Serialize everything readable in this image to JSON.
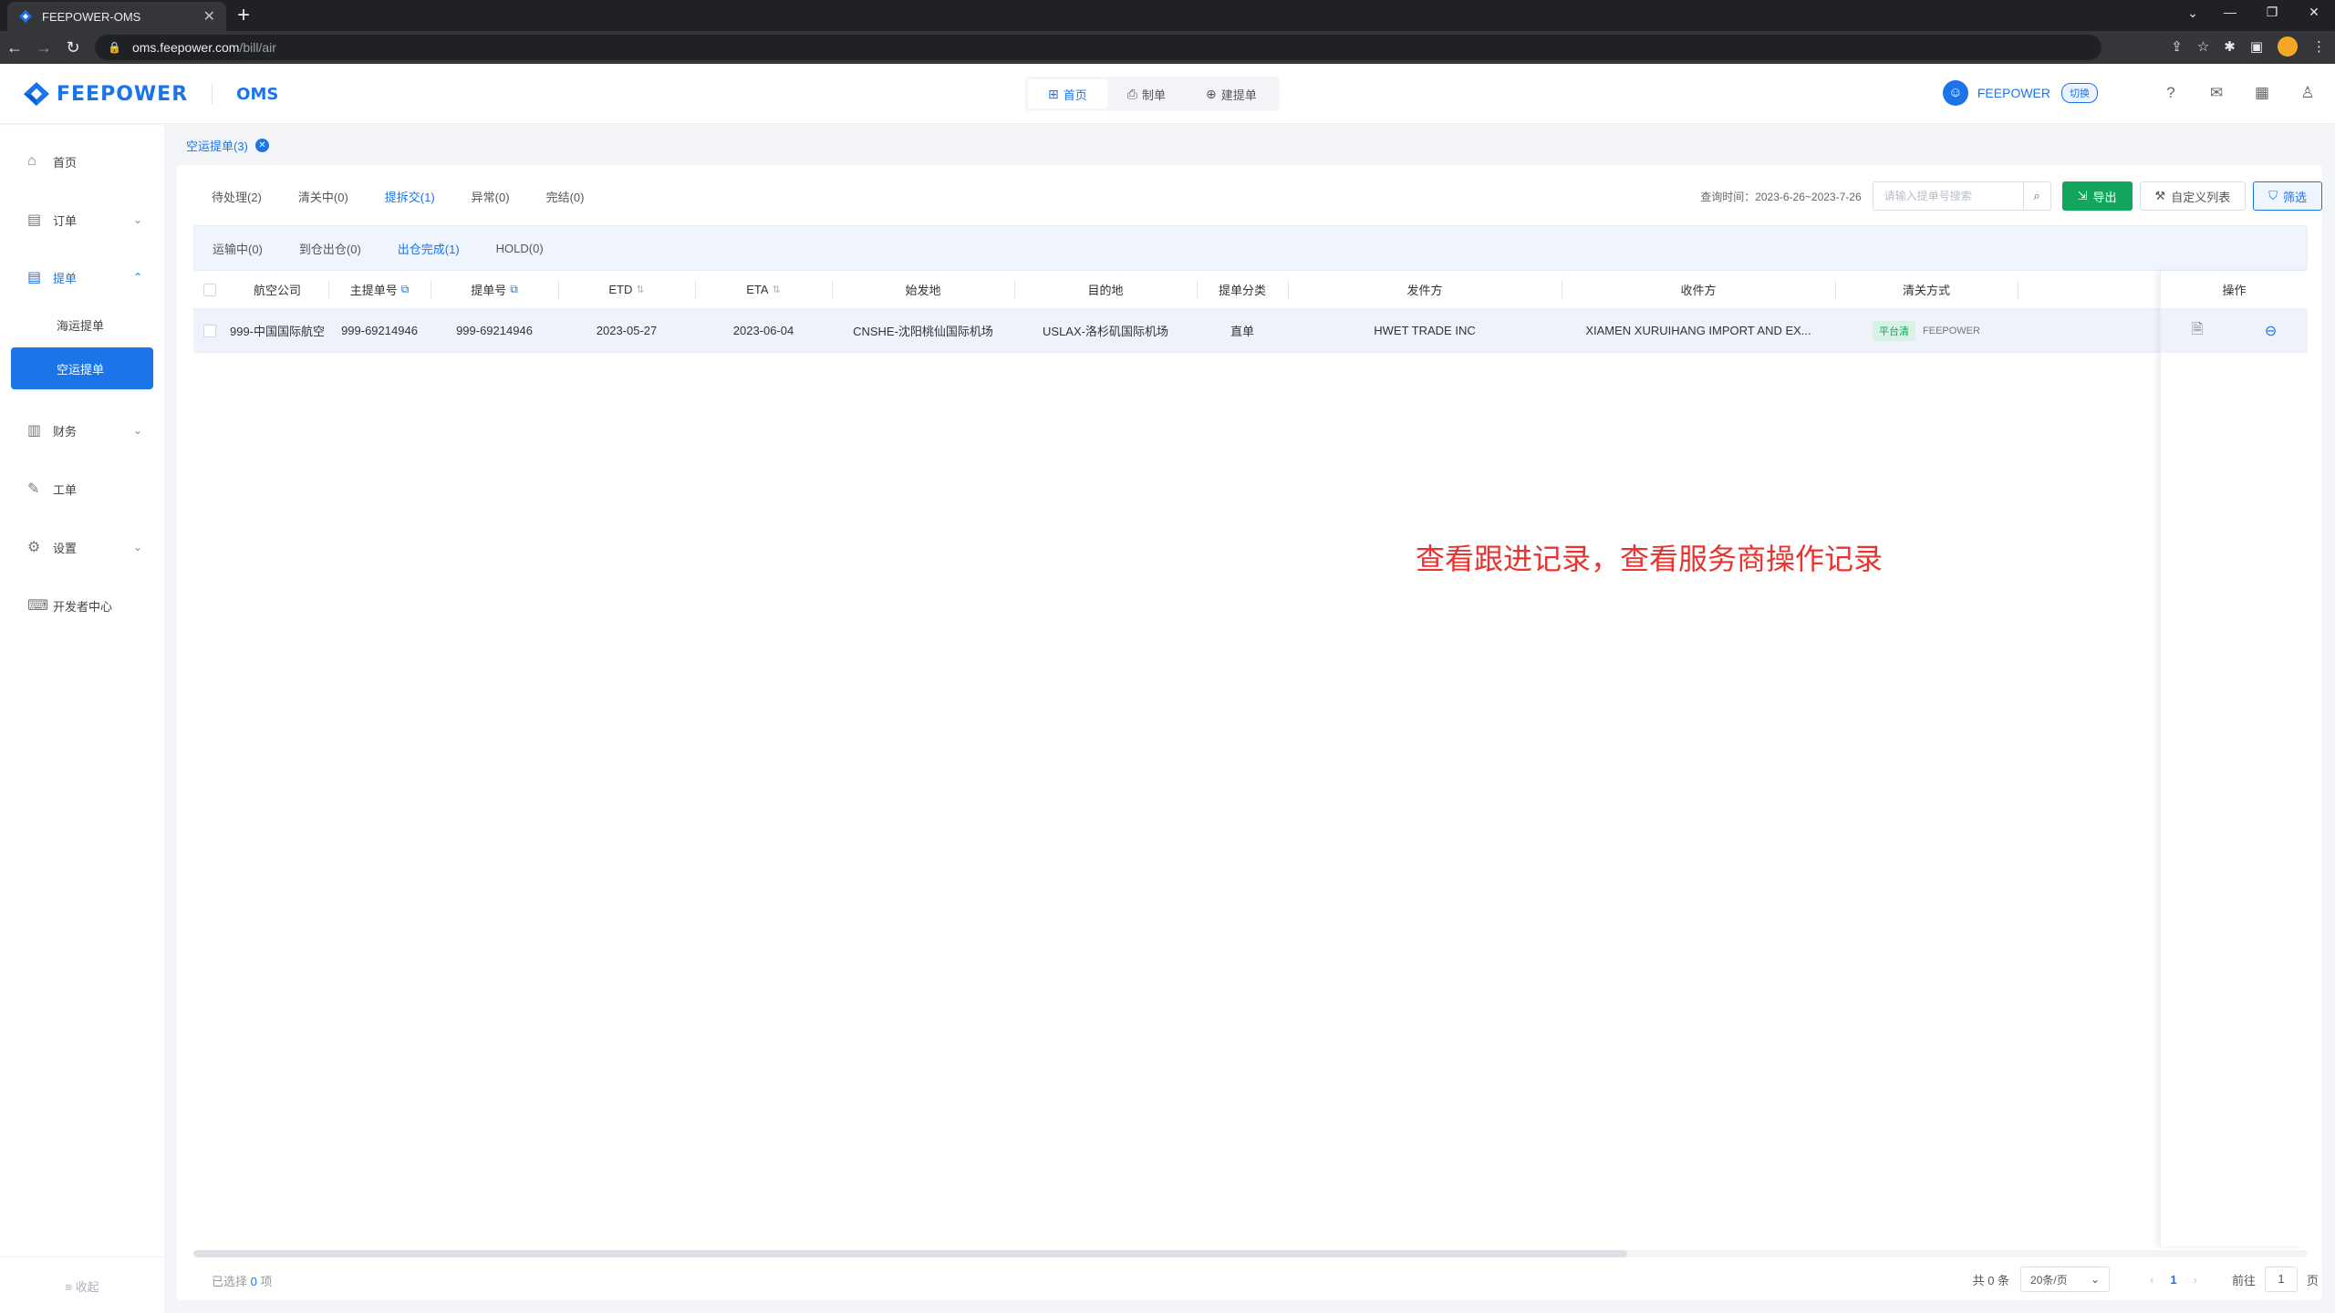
{
  "browser": {
    "tab_title": "FEEPOWER-OMS",
    "url_host": "oms.feepower.com",
    "url_path": "/bill/air"
  },
  "header": {
    "brand": "FEEPOWER",
    "product": "OMS",
    "nav": [
      {
        "label": "首页",
        "icon": "grid-icon"
      },
      {
        "label": "制单",
        "icon": "stamp-icon"
      },
      {
        "label": "建提单",
        "icon": "new-doc-icon"
      }
    ],
    "user": "FEEPOWER",
    "switch_label": "切换"
  },
  "sidebar": {
    "items": [
      {
        "label": "首页",
        "icon": "home-icon"
      },
      {
        "label": "订单",
        "icon": "order-icon"
      },
      {
        "label": "提单",
        "icon": "bill-icon"
      },
      {
        "label": "财务",
        "icon": "finance-icon"
      },
      {
        "label": "工单",
        "icon": "ticket-icon"
      },
      {
        "label": "设置",
        "icon": "settings-icon"
      },
      {
        "label": "开发者中心",
        "icon": "developer-icon"
      }
    ],
    "sub_items": [
      {
        "label": "海运提单"
      },
      {
        "label": "空运提单"
      }
    ],
    "collapse_label": "收起"
  },
  "breadcrumb": {
    "tab": "空运提单(3)"
  },
  "status_tabs": [
    "待处理(2)",
    "清关中(0)",
    "提拆交(1)",
    "异常(0)",
    "完结(0)"
  ],
  "sub_tabs": [
    "运输中(0)",
    "到仓出仓(0)",
    "出仓完成(1)",
    "HOLD(0)"
  ],
  "toolbar": {
    "query_time": "查询时间：2023-6-26~2023-7-26",
    "search_placeholder": "请输入提单号搜索",
    "export": "导出",
    "custom_columns": "自定义列表",
    "filter": "筛选"
  },
  "table": {
    "columns": [
      "航空公司",
      "主提单号",
      "提单号",
      "ETD",
      "ETA",
      "始发地",
      "目的地",
      "提单分类",
      "发件方",
      "收件方",
      "清关方式",
      "操作"
    ],
    "rows": [
      {
        "airline": "999-中国国际航空",
        "master_bill": "999-69214946",
        "bill": "999-69214946",
        "etd": "2023-05-27",
        "eta": "2023-06-04",
        "origin": "CNSHE-沈阳桃仙国际机场",
        "destination": "USLAX-洛杉矶国际机场",
        "category": "直单",
        "shipper": "HWET TRADE INC",
        "consignee": "XIAMEN XURUIHANG IMPORT AND EX...",
        "clearance_tag": "平台清",
        "clearance_by": "FEEPOWER"
      }
    ]
  },
  "footer": {
    "selected_prefix": "已选择",
    "selected_count": "0",
    "selected_suffix": "项",
    "total": "共 0 条",
    "page_size": "20条/页",
    "current_page": "1",
    "goto_label": "前往",
    "goto_value": "1",
    "page_suffix": "页"
  },
  "annotation": "查看跟进记录，查看服务商操作记录"
}
